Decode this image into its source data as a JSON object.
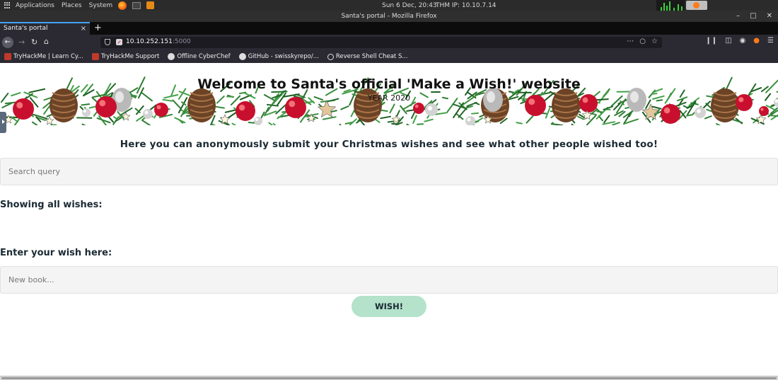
{
  "os_panel": {
    "applications": "Applications",
    "places": "Places",
    "system": "System",
    "clock": "Sun  6 Dec, 20:43",
    "thm_ip": "THM IP:  10.10.7.14"
  },
  "window": {
    "title": "Santa's portal - Mozilla Firefox",
    "minimize": "–",
    "maximize": "□",
    "close": "✕"
  },
  "browser": {
    "tab_title": "Santa's portal",
    "tab_close": "×",
    "new_tab": "+",
    "url_host": "10.10.252.151",
    "url_port": ":5000",
    "bookmarks": [
      {
        "label": "TryHackMe | Learn Cy...",
        "icon": "tryhackme-icon"
      },
      {
        "label": "TryHackMe Support",
        "icon": "tryhackme-icon"
      },
      {
        "label": "Offline CyberChef",
        "icon": "chef-icon"
      },
      {
        "label": "GitHub - swisskyrepo/...",
        "icon": "github-icon"
      },
      {
        "label": "Reverse Shell Cheat S...",
        "icon": "globe-icon"
      }
    ]
  },
  "page": {
    "title": "Welcome to Santa's official 'Make a Wish!' website",
    "year": "YEAR 2020",
    "intro": "Here you can anonymously submit your Christmas wishes and see what other people wished too!",
    "search_placeholder": "Search query",
    "showing_heading": "Showing all wishes:",
    "enter_heading": "Enter your wish here:",
    "wish_placeholder": "New book...",
    "wish_button": "WISH!"
  },
  "colors": {
    "accent_tab": "#45a1ff",
    "button_bg": "#b4e2cb",
    "heading_text": "#1b2a33"
  }
}
